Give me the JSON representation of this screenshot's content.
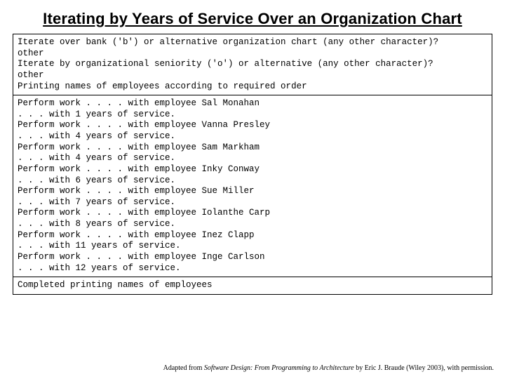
{
  "title": "Iterating by Years of Service Over an Organization Chart",
  "prompt_block": "Iterate over bank ('b') or alternative organization chart (any other character)?\nother\nIterate by organizational seniority ('o') or alternative (any other character)?\nother\nPrinting names of employees according to required order",
  "output_block": "Perform work . . . . with employee Sal Monahan\n. . . with 1 years of service.\nPerform work . . . . with employee Vanna Presley\n. . . with 4 years of service.\nPerform work . . . . with employee Sam Markham\n. . . with 4 years of service.\nPerform work . . . . with employee Inky Conway\n. . . with 6 years of service.\nPerform work . . . . with employee Sue Miller\n. . . with 7 years of service.\nPerform work . . . . with employee Iolanthe Carp\n. . . with 8 years of service.\nPerform work . . . . with employee Inez Clapp\n. . . with 11 years of service.\nPerform work . . . . with employee Inge Carlson\n. . . with 12 years of service.",
  "completion_line": "Completed printing names of employees",
  "footer": {
    "prefix": "Adapted from ",
    "book": "Software Design: From Programming to Architecture",
    "suffix": " by Eric J. Braude (Wiley 2003), with permission."
  }
}
